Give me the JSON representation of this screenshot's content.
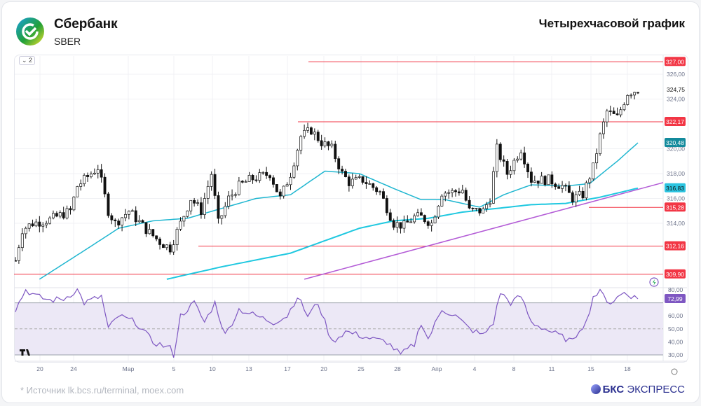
{
  "header": {
    "company": "Сбербанк",
    "ticker": "SBER",
    "chart_title": "Четырехчасовой график"
  },
  "footer": {
    "source": "* Источник lk.bcs.ru/terminal, moex.com",
    "brand_bold": "БКС",
    "brand_rest": " ЭКСПРЕСС"
  },
  "toolbar": {
    "collapse_label": "⌄ 2"
  },
  "colors": {
    "candle": "#111111",
    "ma_fast": "#1fb6d0",
    "ma_slow": "#1fc8e0",
    "level": "#f23645",
    "trend": "#b35bd6",
    "rsi": "#7e57c2"
  },
  "chart_data": {
    "type": "candlestick",
    "title": "Четырехчасовой график",
    "x_ticks": [
      "20",
      "24",
      "Мар",
      "5",
      "10",
      "13",
      "17",
      "20",
      "25",
      "28",
      "Апр",
      "4",
      "8",
      "11",
      "15",
      "18"
    ],
    "y_ticks": [
      "326,00",
      "324,00",
      "320,00",
      "318,00",
      "316,00",
      "314,00"
    ],
    "ylim": [
      309.5,
      327.5
    ],
    "price_keypoints": [
      [
        0,
        311
      ],
      [
        2,
        313.5
      ],
      [
        5,
        314
      ],
      [
        10,
        314.3
      ],
      [
        16,
        315
      ],
      [
        18,
        317
      ],
      [
        24,
        318.5
      ],
      [
        27,
        315
      ],
      [
        29,
        314
      ],
      [
        33,
        315
      ],
      [
        38,
        313.5
      ],
      [
        42,
        312.5
      ],
      [
        45,
        312
      ],
      [
        48,
        314
      ],
      [
        51,
        316
      ],
      [
        54,
        315
      ],
      [
        57,
        318
      ],
      [
        59,
        314
      ],
      [
        62,
        316
      ],
      [
        65,
        317
      ],
      [
        68,
        317.5
      ],
      [
        74,
        318
      ],
      [
        77,
        316
      ],
      [
        80,
        318
      ],
      [
        83,
        321
      ],
      [
        86,
        321.5
      ],
      [
        89,
        320.5
      ],
      [
        92,
        320
      ],
      [
        95,
        318
      ],
      [
        97,
        317.3
      ],
      [
        101,
        317.5
      ],
      [
        106,
        316.5
      ],
      [
        110,
        314
      ],
      [
        113,
        313.8
      ],
      [
        116,
        314.5
      ],
      [
        118,
        314.5
      ],
      [
        121,
        314
      ],
      [
        124,
        316.5
      ],
      [
        127,
        316.5
      ],
      [
        130,
        316.7
      ],
      [
        132,
        315
      ],
      [
        136,
        315
      ],
      [
        138,
        316
      ],
      [
        140,
        320
      ],
      [
        143,
        318
      ],
      [
        147,
        320
      ],
      [
        150,
        317.5
      ],
      [
        155,
        317.5
      ],
      [
        159,
        317
      ],
      [
        162,
        316
      ],
      [
        165,
        316.3
      ],
      [
        168,
        318.5
      ],
      [
        170,
        321
      ],
      [
        172,
        323
      ],
      [
        175,
        322.5
      ],
      [
        178,
        324.5
      ],
      [
        181,
        324.75
      ]
    ],
    "ma_fast_keypoints": [
      [
        7,
        309.5
      ],
      [
        20,
        311.8
      ],
      [
        30,
        313.6
      ],
      [
        40,
        314.2
      ],
      [
        50,
        314.4
      ],
      [
        60,
        315.2
      ],
      [
        70,
        316
      ],
      [
        80,
        316.3
      ],
      [
        90,
        318.2
      ],
      [
        100,
        318
      ],
      [
        110,
        316.8
      ],
      [
        118,
        315.9
      ],
      [
        125,
        315.9
      ],
      [
        135,
        315.3
      ],
      [
        142,
        316.3
      ],
      [
        150,
        317.1
      ],
      [
        160,
        317
      ],
      [
        167,
        317.2
      ],
      [
        175,
        319
      ],
      [
        181,
        320.48
      ]
    ],
    "ma_slow_keypoints": [
      [
        44,
        309.5
      ],
      [
        60,
        310.5
      ],
      [
        80,
        311.6
      ],
      [
        90,
        312.6
      ],
      [
        100,
        313.6
      ],
      [
        110,
        314.2
      ],
      [
        120,
        314.4
      ],
      [
        130,
        314.9
      ],
      [
        140,
        315.2
      ],
      [
        150,
        315.5
      ],
      [
        160,
        315.6
      ],
      [
        170,
        316.1
      ],
      [
        181,
        316.83
      ]
    ],
    "rsi_keypoints": [
      [
        0,
        65
      ],
      [
        3,
        80
      ],
      [
        6,
        75
      ],
      [
        10,
        72
      ],
      [
        14,
        73
      ],
      [
        18,
        80
      ],
      [
        20,
        70
      ],
      [
        25,
        75
      ],
      [
        27,
        50
      ],
      [
        30,
        60
      ],
      [
        35,
        55
      ],
      [
        40,
        40
      ],
      [
        45,
        35
      ],
      [
        46,
        30
      ],
      [
        48,
        60
      ],
      [
        52,
        70
      ],
      [
        55,
        55
      ],
      [
        58,
        70
      ],
      [
        61,
        45
      ],
      [
        65,
        65
      ],
      [
        70,
        60
      ],
      [
        75,
        55
      ],
      [
        79,
        60
      ],
      [
        82,
        75
      ],
      [
        85,
        60
      ],
      [
        88,
        70
      ],
      [
        92,
        40
      ],
      [
        96,
        48
      ],
      [
        100,
        45
      ],
      [
        104,
        42
      ],
      [
        108,
        40
      ],
      [
        112,
        30
      ],
      [
        116,
        38
      ],
      [
        118,
        55
      ],
      [
        120,
        42
      ],
      [
        124,
        65
      ],
      [
        128,
        60
      ],
      [
        132,
        50
      ],
      [
        136,
        45
      ],
      [
        139,
        55
      ],
      [
        141,
        78
      ],
      [
        144,
        70
      ],
      [
        147,
        75
      ],
      [
        150,
        55
      ],
      [
        154,
        50
      ],
      [
        158,
        45
      ],
      [
        162,
        40
      ],
      [
        164,
        50
      ],
      [
        166,
        55
      ],
      [
        168,
        75
      ],
      [
        170,
        78
      ],
      [
        173,
        70
      ],
      [
        177,
        78
      ],
      [
        181,
        72.99
      ]
    ],
    "horizontal_levels": [
      {
        "value": 327.0,
        "label": "327,00"
      },
      {
        "value": 322.17,
        "label": "322,17"
      },
      {
        "value": 315.28,
        "label": "315,28"
      },
      {
        "value": 312.16,
        "label": "312,16"
      },
      {
        "value": 309.9,
        "label": "309,90"
      }
    ],
    "last_price": {
      "value": 324.75,
      "label": "324,75"
    },
    "ma_fast_last": {
      "value": 320.48,
      "label": "320,48"
    },
    "ma_slow_last": {
      "value": 316.83,
      "label": "316,83"
    },
    "trendline": [
      [
        84,
        309.5
      ],
      [
        190,
        317.4
      ]
    ],
    "rsi": {
      "ylim": [
        29,
        81
      ],
      "ticks": [
        "80,00",
        "60,00",
        "50,00",
        "40,00",
        "30,00"
      ],
      "levels": [
        70,
        50,
        30
      ],
      "last": {
        "value": 72.99,
        "label": "72,99"
      }
    }
  }
}
